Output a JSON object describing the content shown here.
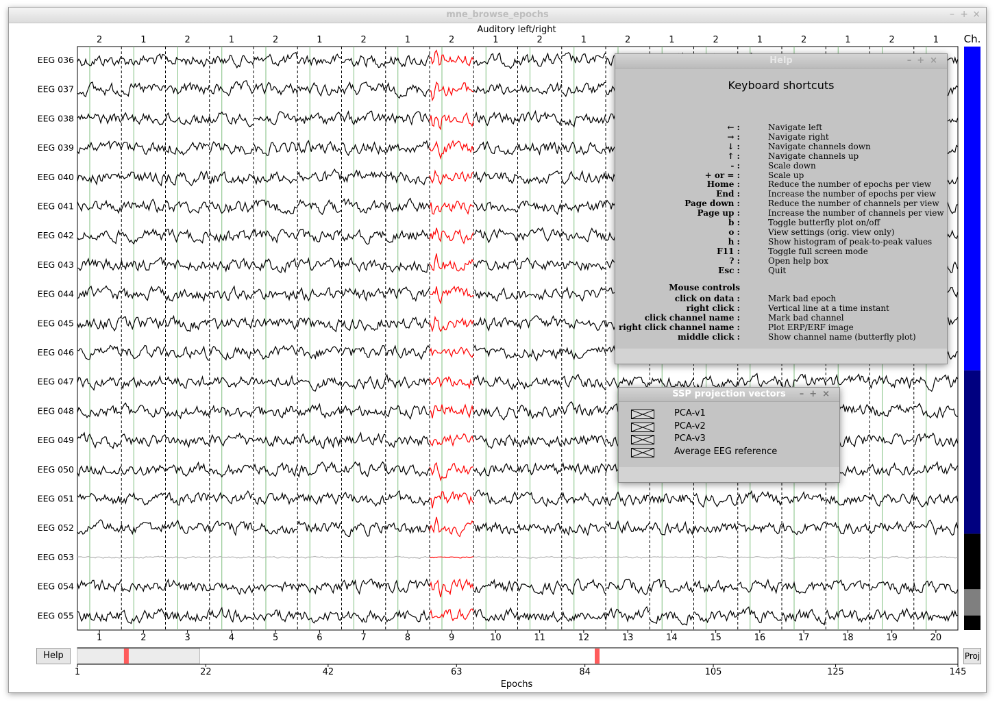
{
  "window": {
    "title": "mne_browse_epochs"
  },
  "plot": {
    "title": "Auditory left/right",
    "epoch_event_ids": [
      "2",
      "1",
      "2",
      "1",
      "2",
      "1",
      "2",
      "1",
      "2",
      "1",
      "2",
      "1",
      "2",
      "1",
      "2",
      "1",
      "2",
      "1",
      "2",
      "1"
    ],
    "epoch_numbers": [
      "1",
      "2",
      "3",
      "4",
      "5",
      "6",
      "7",
      "8",
      "9",
      "10",
      "11",
      "12",
      "13",
      "14",
      "15",
      "16",
      "17",
      "18",
      "19",
      "20"
    ],
    "channels": [
      {
        "name": "EEG 036",
        "bad": false
      },
      {
        "name": "EEG 037",
        "bad": false
      },
      {
        "name": "EEG 038",
        "bad": false
      },
      {
        "name": "EEG 039",
        "bad": false
      },
      {
        "name": "EEG 040",
        "bad": false
      },
      {
        "name": "EEG 041",
        "bad": false
      },
      {
        "name": "EEG 042",
        "bad": false
      },
      {
        "name": "EEG 043",
        "bad": false
      },
      {
        "name": "EEG 044",
        "bad": false
      },
      {
        "name": "EEG 045",
        "bad": false
      },
      {
        "name": "EEG 046",
        "bad": false
      },
      {
        "name": "EEG 047",
        "bad": false
      },
      {
        "name": "EEG 048",
        "bad": false
      },
      {
        "name": "EEG 049",
        "bad": false
      },
      {
        "name": "EEG 050",
        "bad": false
      },
      {
        "name": "EEG 051",
        "bad": false
      },
      {
        "name": "EEG 052",
        "bad": false
      },
      {
        "name": "EEG 053",
        "bad": true
      },
      {
        "name": "EEG 054",
        "bad": false
      },
      {
        "name": "EEG 055",
        "bad": false
      }
    ],
    "bad_epoch_number": "9",
    "colors": {
      "trace": "#000000",
      "bad_epoch": "#ff0000",
      "bad_channel": "#b4b4b4",
      "time_line": "#7fbf7f"
    }
  },
  "channel_bar": {
    "label": "Ch.",
    "segments": [
      {
        "color": "#0000ff",
        "share": 0.555
      },
      {
        "color": "#000080",
        "share": 0.28
      },
      {
        "color": "#000000",
        "share": 0.095
      },
      {
        "color": "#7f7f7f",
        "share": 0.045
      },
      {
        "color": "#000000",
        "share": 0.025
      }
    ]
  },
  "buttons": {
    "help": "Help",
    "proj": "Proj"
  },
  "epochs_axis": {
    "label": "Epochs",
    "ticks": [
      "1",
      "22",
      "42",
      "63",
      "84",
      "105",
      "125",
      "145"
    ],
    "range": [
      1,
      145
    ],
    "view_range": [
      1,
      21
    ],
    "bad_epochs": [
      9,
      86
    ],
    "bad_color": "#ff5b5b"
  },
  "help_dialog": {
    "title": "Help",
    "heading": "Keyboard shortcuts",
    "shortcuts": [
      {
        "key": "← :",
        "desc": "Navigate left"
      },
      {
        "key": "→ :",
        "desc": "Navigate right"
      },
      {
        "key": "↓ :",
        "desc": "Navigate channels down"
      },
      {
        "key": "↑ :",
        "desc": "Navigate channels up"
      },
      {
        "key": "- :",
        "desc": "Scale down"
      },
      {
        "key": "+ or = :",
        "desc": "Scale up"
      },
      {
        "key": "Home :",
        "desc": "Reduce the number of epochs per view"
      },
      {
        "key": "End :",
        "desc": "Increase the number of epochs per view"
      },
      {
        "key": "Page down :",
        "desc": "Reduce the number of channels per view"
      },
      {
        "key": "Page up :",
        "desc": "Increase the number of channels per view"
      },
      {
        "key": "b :",
        "desc": "Toggle butterfly plot on/off"
      },
      {
        "key": "o :",
        "desc": "View settings (orig. view only)"
      },
      {
        "key": "h :",
        "desc": "Show histogram of peak-to-peak values"
      },
      {
        "key": "F11 :",
        "desc": "Toggle full screen mode"
      },
      {
        "key": "? :",
        "desc": "Open help box"
      },
      {
        "key": "Esc :",
        "desc": "Quit"
      }
    ],
    "mouse_heading": "Mouse controls",
    "mouse": [
      {
        "key": "click on data :",
        "desc": "Mark bad epoch"
      },
      {
        "key": "right click :",
        "desc": "Vertical line at a time instant"
      },
      {
        "key": "click channel name :",
        "desc": "Mark bad channel"
      },
      {
        "key": "right click channel name :",
        "desc": "Plot ERP/ERF image"
      },
      {
        "key": "middle click :",
        "desc": "Show channel name (butterfly plot)"
      }
    ]
  },
  "ssp_dialog": {
    "title": "SSP projection vectors",
    "items": [
      "PCA-v1",
      "PCA-v2",
      "PCA-v3",
      "Average EEG reference"
    ]
  }
}
